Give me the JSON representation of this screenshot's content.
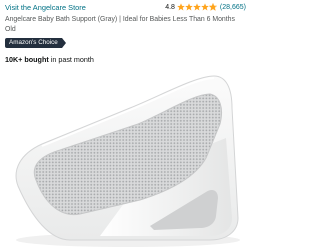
{
  "store_link": "Visit the Angelcare Store",
  "rating": {
    "value": "4.8",
    "stars": 4.8,
    "count": "(28,665)"
  },
  "product": {
    "title": "Angelcare Baby Bath Support (Gray) | Ideal for Babies Less Than 6 Months Old",
    "badge": "Amazon's Choice",
    "bought_bold": "10K+ bought",
    "bought_rest": " in past month",
    "image_name": "baby-bath-support-image"
  },
  "colors": {
    "link": "#007185",
    "star": "#FFA41C",
    "badge_bg": "#232F3E"
  }
}
